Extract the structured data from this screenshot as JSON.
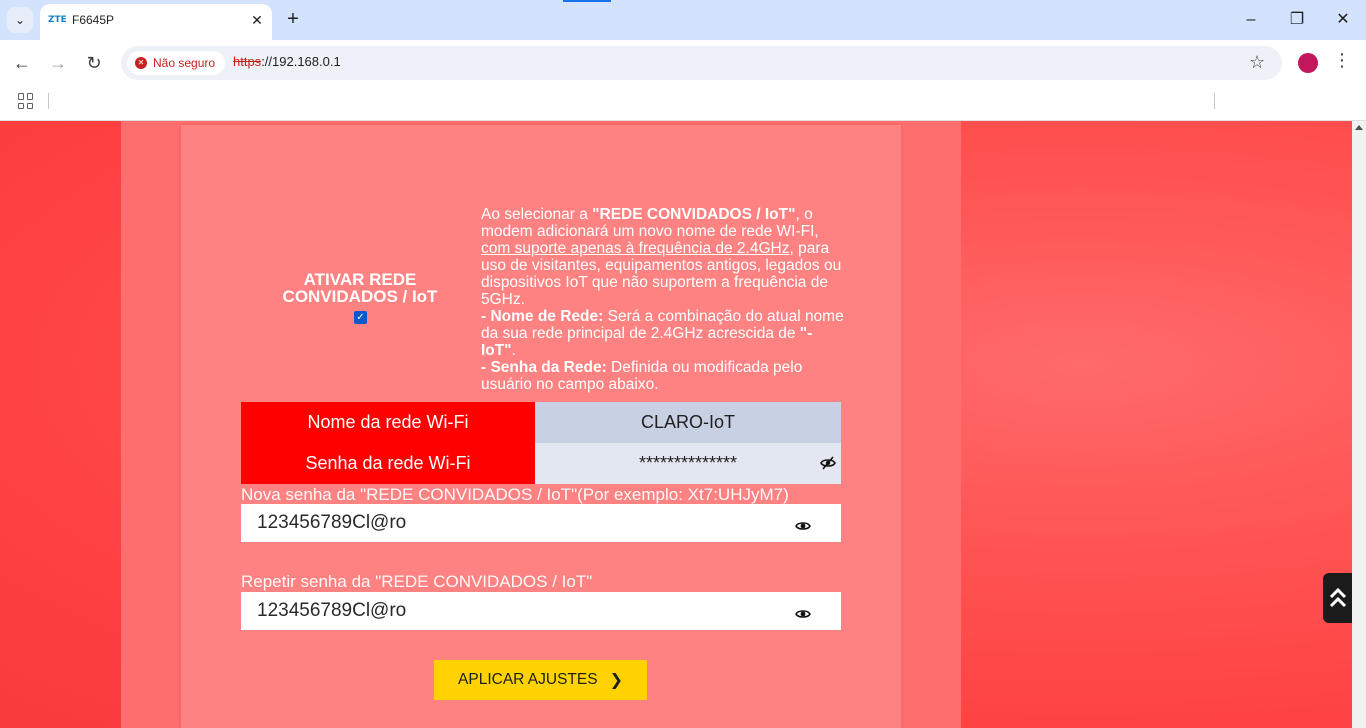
{
  "browser": {
    "tab_title": "F6645P",
    "tab_favicon_text": "ZTE",
    "security_label": "Não seguro",
    "url_scheme": "https",
    "url_rest": "://192.168.0.1"
  },
  "guest_network": {
    "enable_label_line1": "ATIVAR REDE",
    "enable_label_line2": "CONVIDADOS / IoT",
    "enabled": true,
    "description": {
      "p1_a": "Ao selecionar a ",
      "p1_b": "\"REDE CONVIDADOS / IoT\"",
      "p1_c": ", o modem adicionará um novo nome de rede WI-FI, ",
      "p1_u": "com suporte apenas à frequência de 2.4GHz",
      "p1_d": ", para uso de visitantes, equipamentos antigos, legados ou dispositivos IoT que não suportem a frequência de 5GHz.",
      "p2_label": "- Nome de Rede:",
      "p2_text": " Será a combinação do atual nome da sua rede principal de 2.4GHz acrescida de ",
      "p2_suffix": "\"-IoT\"",
      "p2_end": ".",
      "p3_label": "- Senha da Rede:",
      "p3_text": " Definida ou modificada pelo usuário no campo abaixo."
    },
    "table": {
      "ssid_label": "Nome da rede Wi-Fi",
      "ssid_value": "CLARO-IoT",
      "password_label": "Senha da rede Wi-Fi",
      "password_value": "**************"
    },
    "new_password": {
      "label": "Nova senha da \"REDE CONVIDADOS / IoT\"(Por exemplo: Xt7:UHJyM7)",
      "value": "123456789Cl@ro"
    },
    "repeat_password": {
      "label": "Repetir senha da \"REDE CONVIDADOS / IoT\"",
      "value": "123456789Cl@ro"
    },
    "apply_label": "APLICAR AJUSTES"
  },
  "colors": {
    "accent_red": "#ff0000",
    "button_yellow": "#ffd200",
    "panel": "#ff8282"
  }
}
